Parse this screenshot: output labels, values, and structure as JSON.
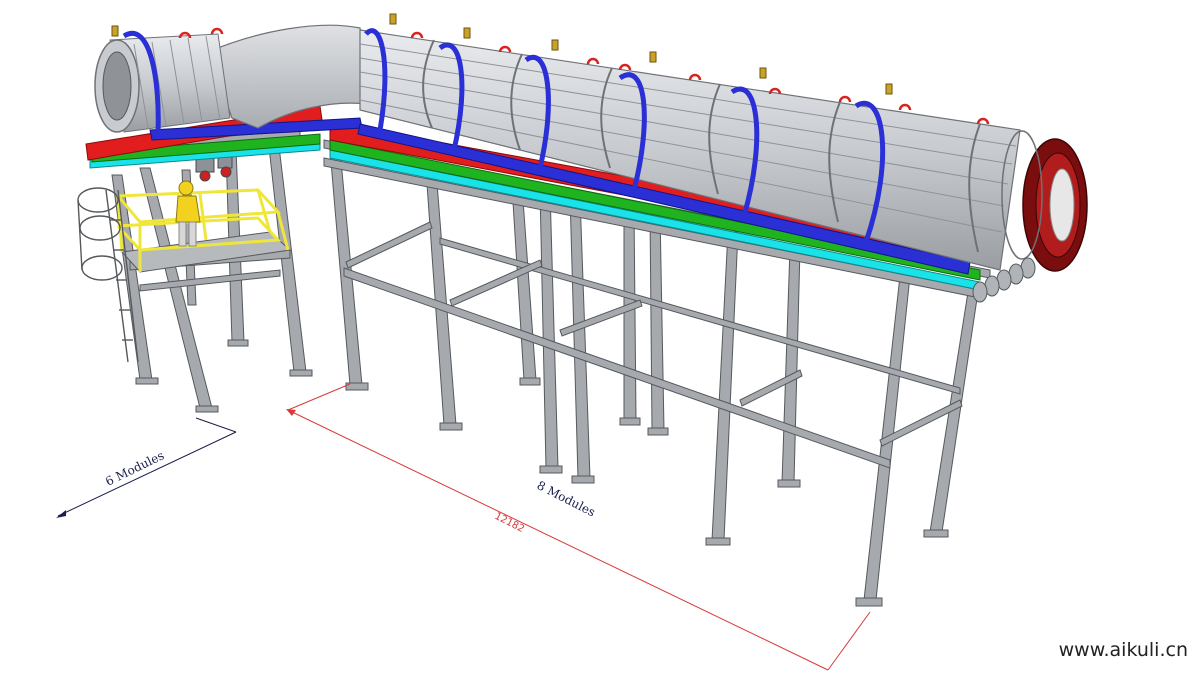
{
  "labels": {
    "modules_left": "6 Modules",
    "modules_right": "8 Modules",
    "dimension": "12182"
  },
  "watermark": "www.aikuli.cn",
  "colors": {
    "steel": "#a6a9ad",
    "steel_dark": "#6e7276",
    "module_body": "#cfd2d6",
    "module_rib": "#8f9398",
    "pipe_blue": "#2a2fd6",
    "pipe_red": "#e21d1d",
    "pipe_green": "#1fb31f",
    "pipe_cyan": "#19e2e8",
    "flange_dark_red": "#7a0d0d",
    "railing_yellow": "#f0e63a",
    "hook_red": "#d9231f",
    "valve_gold": "#c9a227",
    "dimension_red": "#d83a3a",
    "label_navy": "#1a1f4d"
  }
}
